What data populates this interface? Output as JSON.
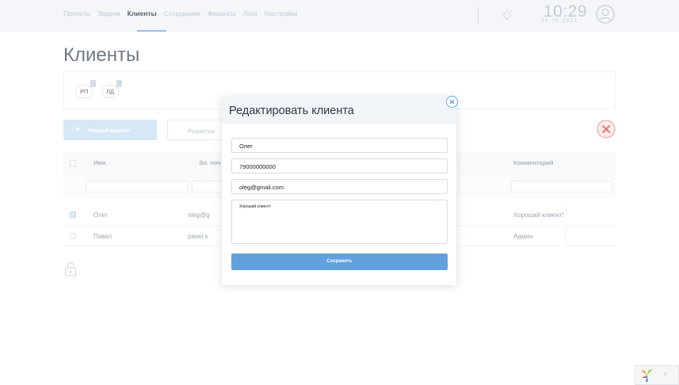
{
  "nav": {
    "items": [
      "Проекты",
      "Задачи",
      "Клиенты",
      "Сотрудники",
      "Финансы",
      "Логи",
      "Настройки"
    ],
    "active_index": 2
  },
  "header": {
    "time": "10:29",
    "date": "28.06.2021"
  },
  "page": {
    "title": "Клиенты"
  },
  "filters": {
    "chips": [
      {
        "label": "РП",
        "badge": ""
      },
      {
        "label": "ЛД",
        "badge": ""
      }
    ]
  },
  "toolbar": {
    "new_client": "Новый клиент",
    "edit": "Редактир"
  },
  "table": {
    "columns": [
      "Имя",
      "Эл. поч",
      "Комментарий"
    ],
    "rows": [
      {
        "checked": true,
        "name": "Олег",
        "email": "oleg@g",
        "comment": "Хороший клиент!"
      },
      {
        "checked": false,
        "name": "Павел",
        "email": "pavel.s",
        "comment": "Админ"
      }
    ]
  },
  "modal": {
    "title": "Редактировать клиента",
    "name_value": "Олег",
    "phone_value": "79000000000",
    "email_value": "oleg@gmail.com",
    "comment_value": "Хороший клиент!",
    "save_label": "Сохранить"
  },
  "colors": {
    "accent": "#619fdd",
    "delete_red": "#e35d5d",
    "nav_inactive": "#b6c1cf",
    "nav_active": "#3a4756"
  },
  "icons": {
    "bulb": "lightbulb-icon",
    "avatar": "user-avatar-icon",
    "delete": "close-circle-icon",
    "modal_close": "close-icon",
    "lock": "unlock-icon",
    "yii": "yii-logo-icon"
  }
}
